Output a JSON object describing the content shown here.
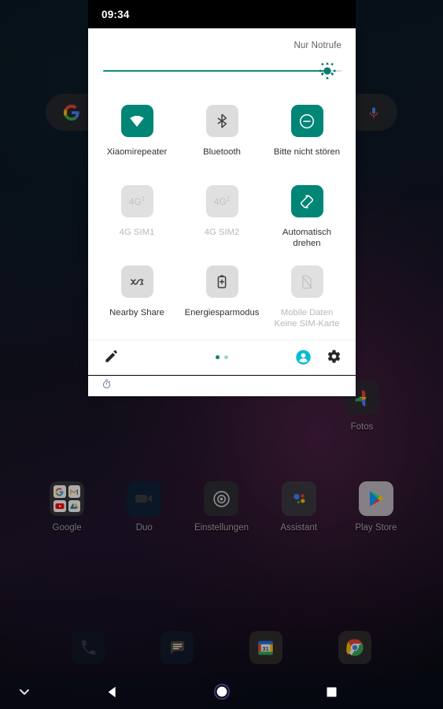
{
  "status_bar": {
    "clock": "09:34"
  },
  "quick_settings": {
    "carrier_label": "Nur Notrufe",
    "brightness": {
      "name": "brightness-slider",
      "value_percent": 94,
      "thumb_icon": "sun-brightness-icon"
    },
    "tiles": [
      {
        "label": "Xiaomirepeater",
        "sublabel": "",
        "icon": "wifi-icon",
        "state": "on",
        "name": "qs-tile-wifi"
      },
      {
        "label": "Bluetooth",
        "sublabel": "",
        "icon": "bluetooth-icon",
        "state": "off",
        "name": "qs-tile-bluetooth"
      },
      {
        "label": "Bitte nicht stören",
        "sublabel": "",
        "icon": "do-not-disturb-icon",
        "state": "on",
        "name": "qs-tile-do-not-disturb"
      },
      {
        "label": "4G SIM1",
        "sublabel": "",
        "icon": "4g-sim1-icon",
        "icon_text": "4G",
        "icon_sup": "1",
        "state": "disabled",
        "name": "qs-tile-4g-sim1"
      },
      {
        "label": "4G SIM2",
        "sublabel": "",
        "icon": "4g-sim2-icon",
        "icon_text": "4G",
        "icon_sup": "2",
        "state": "disabled",
        "name": "qs-tile-4g-sim2"
      },
      {
        "label": "Automatisch drehen",
        "sublabel": "",
        "icon": "auto-rotate-icon",
        "state": "on",
        "name": "qs-tile-auto-rotate"
      },
      {
        "label": "Nearby Share",
        "sublabel": "",
        "icon": "nearby-share-icon",
        "state": "off",
        "name": "qs-tile-nearby-share"
      },
      {
        "label": "Energiesparmodus",
        "sublabel": "",
        "icon": "battery-saver-icon",
        "state": "off",
        "name": "qs-tile-battery-saver"
      },
      {
        "label": "Mobile Daten",
        "sublabel": "Keine SIM-Karte",
        "icon": "mobile-data-off-icon",
        "state": "disabled",
        "name": "qs-tile-mobile-data"
      }
    ],
    "footer": {
      "edit_icon": "pencil-edit-icon",
      "page_dots": 2,
      "active_dot": 0,
      "user_icon": "user-avatar-icon",
      "settings_icon": "gear-icon"
    }
  },
  "notification": {
    "icon": "stopwatch-timer-icon",
    "text": ""
  },
  "home_screen": {
    "search_widget": {
      "logo_icon": "google-g-icon",
      "mic_icon": "microphone-icon"
    },
    "fotos": {
      "label": "Fotos",
      "icon": "google-photos-icon"
    },
    "app_row": [
      {
        "label": "Google",
        "icon": "google-folder-icon"
      },
      {
        "label": "Duo",
        "icon": "google-duo-icon"
      },
      {
        "label": "Einstellungen",
        "icon": "settings-gear-icon"
      },
      {
        "label": "Assistant",
        "icon": "google-assistant-icon"
      },
      {
        "label": "Play Store",
        "icon": "play-store-icon"
      }
    ],
    "dock": [
      {
        "label": "Telefon",
        "icon": "phone-icon"
      },
      {
        "label": "Messages",
        "icon": "messages-icon"
      },
      {
        "label": "Kalender",
        "icon": "calendar-icon"
      },
      {
        "label": "Chrome",
        "icon": "chrome-icon"
      }
    ]
  },
  "nav_bar": {
    "hide_icon": "chevron-down-icon",
    "back_icon": "back-triangle-icon",
    "home_icon": "home-circle-icon",
    "recents_icon": "recents-square-icon"
  },
  "colors": {
    "accent_teal": "#008577",
    "tile_off_gray": "#dcdcdc",
    "panel_bg": "#ffffff",
    "status_bar_bg": "#000000",
    "user_icon_cyan": "#00bcd4"
  }
}
